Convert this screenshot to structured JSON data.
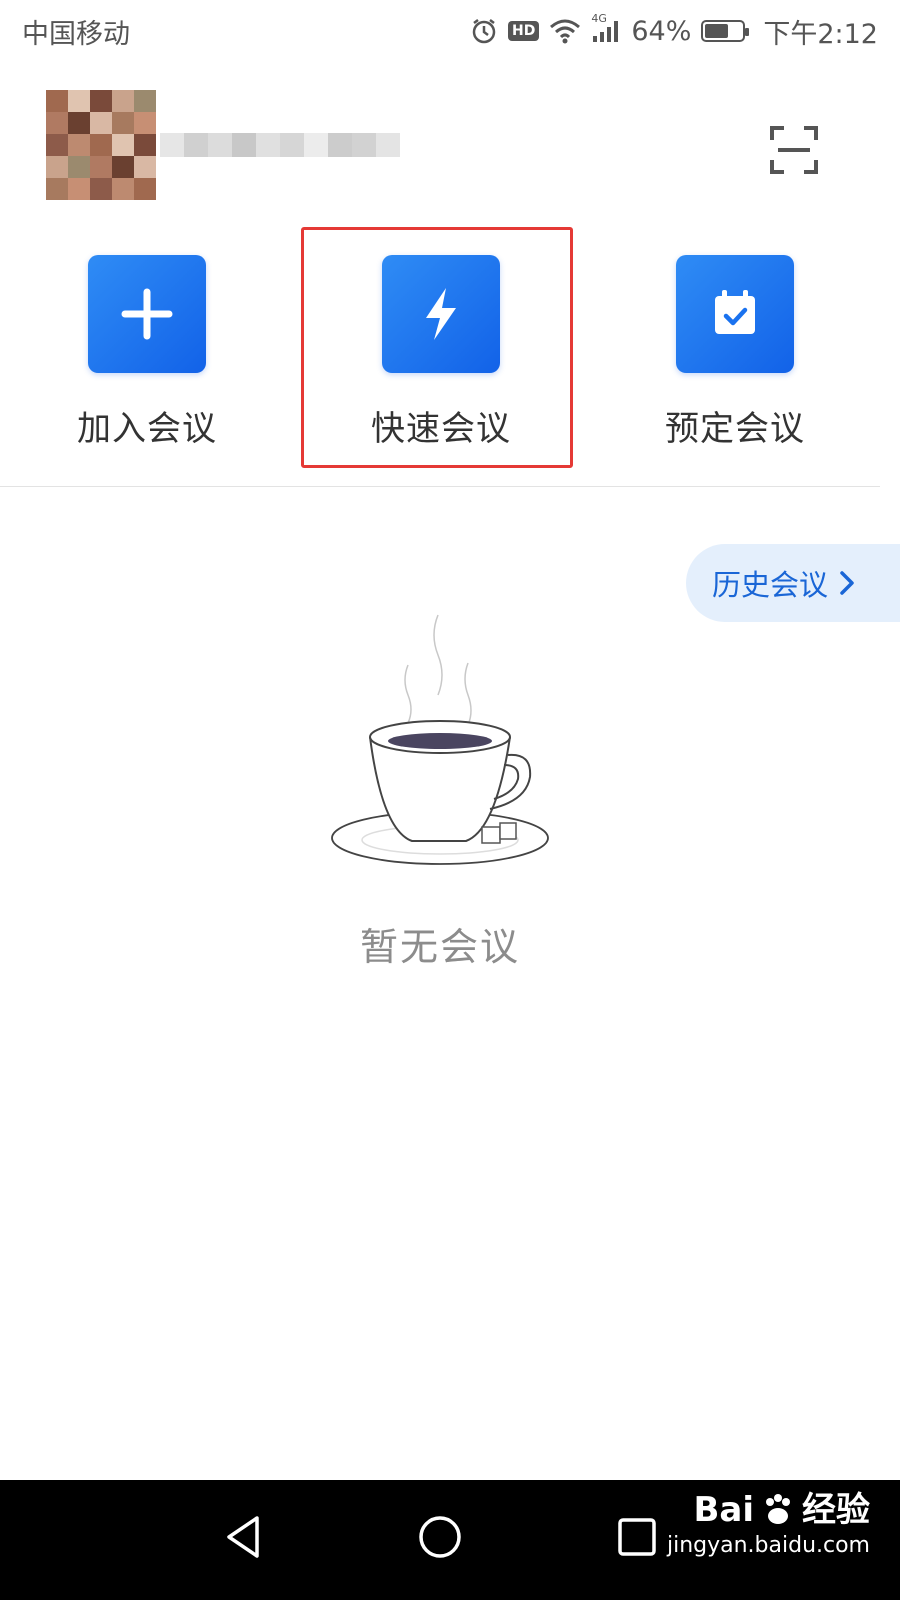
{
  "status_bar": {
    "carrier": "中国移动",
    "hd": "HD",
    "network": "4G",
    "battery_percent": "64%",
    "battery_level": 0.64,
    "time": "下午2:12"
  },
  "profile": {
    "avatar_alt": "blurred-avatar",
    "scan_icon": "scan-icon"
  },
  "actions": [
    {
      "label": "加入会议",
      "icon": "plus-icon"
    },
    {
      "label": "快速会议",
      "icon": "lightning-icon"
    },
    {
      "label": "预定会议",
      "icon": "calendar-check-icon"
    }
  ],
  "history": {
    "label": "历史会议"
  },
  "empty_state": {
    "text": "暂无会议",
    "icon": "coffee-cup-icon"
  },
  "nav": {
    "back_icon": "back-triangle-icon",
    "home_icon": "home-circle-icon",
    "recents_icon": "recents-square-icon"
  },
  "watermark": {
    "brand": "Bai",
    "brand_cn": "经验",
    "url": "jingyan.baidu.com"
  },
  "colors": {
    "accent": "#1a66d6",
    "tile": "#1a72ef",
    "highlight": "#e53935"
  }
}
